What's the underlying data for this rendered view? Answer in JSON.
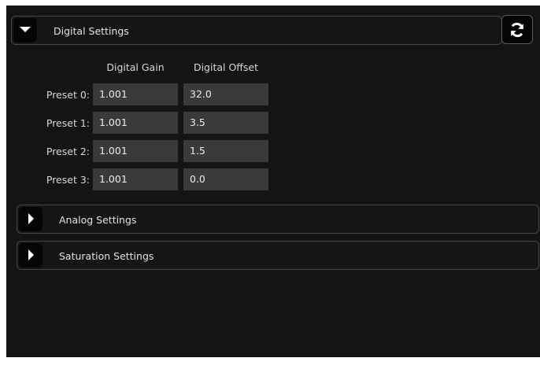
{
  "sections": {
    "digital": {
      "label": "Digital Settings",
      "state": "expanded"
    },
    "analog": {
      "label": "Analog Settings",
      "state": "collapsed"
    },
    "saturation": {
      "label": "Saturation Settings",
      "state": "collapsed"
    }
  },
  "refresh_icon": "refresh-icon",
  "digital_table": {
    "columns": [
      "Digital Gain",
      "Digital Offset"
    ],
    "rows": [
      {
        "label": "Preset 0:",
        "gain": "1.001",
        "offset": "32.0"
      },
      {
        "label": "Preset 1:",
        "gain": "1.001",
        "offset": "3.5"
      },
      {
        "label": "Preset 2:",
        "gain": "1.001",
        "offset": "1.5"
      },
      {
        "label": "Preset 3:",
        "gain": "1.001",
        "offset": "0.0"
      }
    ]
  },
  "colors": {
    "panel_bg": "#141414",
    "input_bg": "#3a3a3a",
    "border": "#474747",
    "text": "#d8d8d8"
  }
}
